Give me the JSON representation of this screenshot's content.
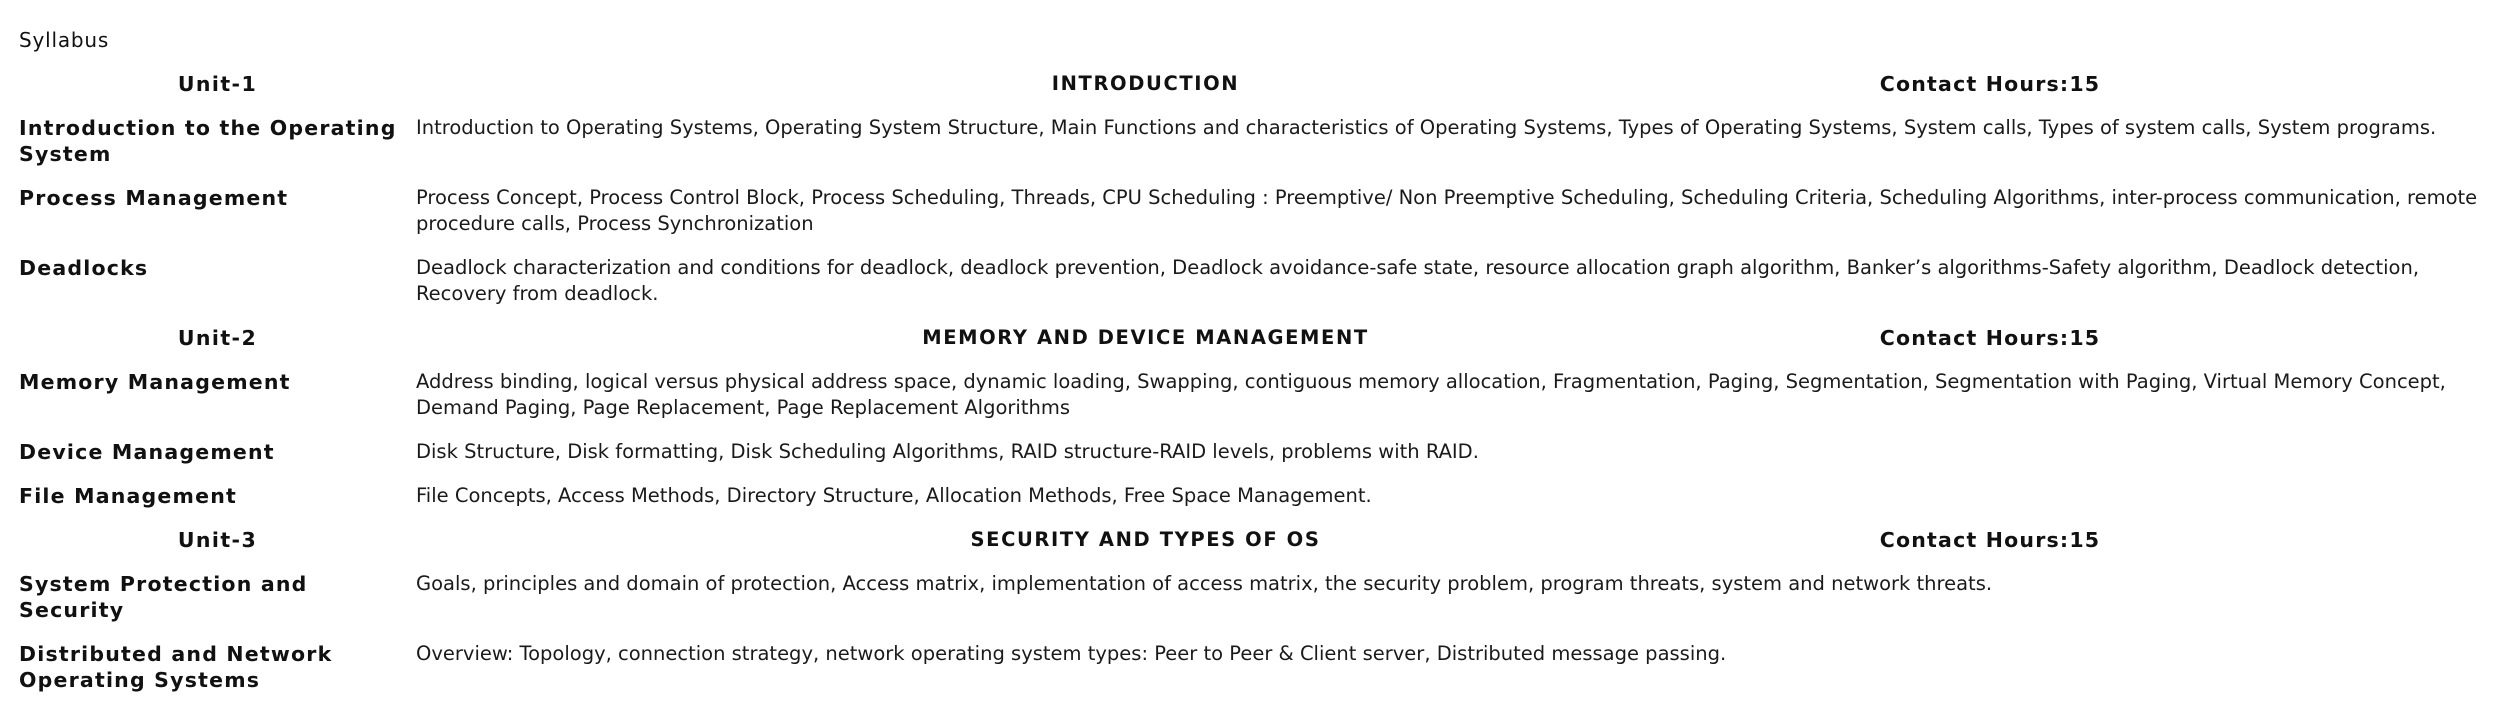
{
  "title": "Syllabus",
  "units": [
    {
      "unit": "Unit-1",
      "heading": "INTRODUCTION",
      "hours": "Contact Hours:15",
      "topics": [
        {
          "name": "Introduction to the Operating System",
          "content": "Introduction to Operating Systems, Operating System Structure, Main Functions and characteristics of Operating Systems, Types of Operating Systems, System calls, Types of system calls, System programs."
        },
        {
          "name": "Process Management",
          "content": "Process Concept, Process Control Block, Process Scheduling, Threads, CPU Scheduling : Preemptive/ Non Preemptive Scheduling, Scheduling Criteria, Scheduling Algorithms, inter-process communication, remote procedure calls, Process Synchronization"
        },
        {
          "name": "Deadlocks",
          "content": "Deadlock characterization and conditions for deadlock, deadlock prevention, Deadlock avoidance-safe state, resource allocation graph algorithm, Banker’s algorithms-Safety algorithm, Deadlock detection, Recovery from deadlock."
        }
      ]
    },
    {
      "unit": "Unit-2",
      "heading": "MEMORY AND DEVICE MANAGEMENT",
      "hours": "Contact Hours:15",
      "topics": [
        {
          "name": "Memory Management",
          "content": "Address binding, logical versus physical address space, dynamic loading, Swapping, contiguous memory allocation, Fragmentation, Paging, Segmentation, Segmentation with Paging, Virtual Memory Concept, Demand Paging, Page Replacement, Page Replacement Algorithms"
        },
        {
          "name": "Device Management",
          "content": "Disk Structure, Disk formatting, Disk Scheduling Algorithms, RAID structure-RAID levels, problems with RAID."
        },
        {
          "name": "File Management",
          "content": "File Concepts, Access Methods, Directory Structure, Allocation Methods, Free Space Management."
        }
      ]
    },
    {
      "unit": "Unit-3",
      "heading": "SECURITY AND TYPES OF OS",
      "hours": "Contact Hours:15",
      "topics": [
        {
          "name": "System Protection and Security",
          "content": "Goals, principles and domain of protection, Access matrix, implementation of access matrix, the security problem, program threats, system and network threats."
        },
        {
          "name": "Distributed and Network Operating Systems",
          "content": "Overview: Topology, connection strategy, network operating system types: Peer to Peer & Client server, Distributed message passing."
        }
      ]
    }
  ]
}
